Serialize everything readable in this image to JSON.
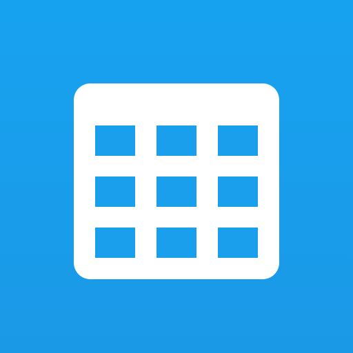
{
  "icon": {
    "name": "calendar-grid-icon",
    "background_color": "#1a9fed",
    "foreground_color": "#ffffff",
    "grid": {
      "rows": 3,
      "columns": 3
    }
  }
}
